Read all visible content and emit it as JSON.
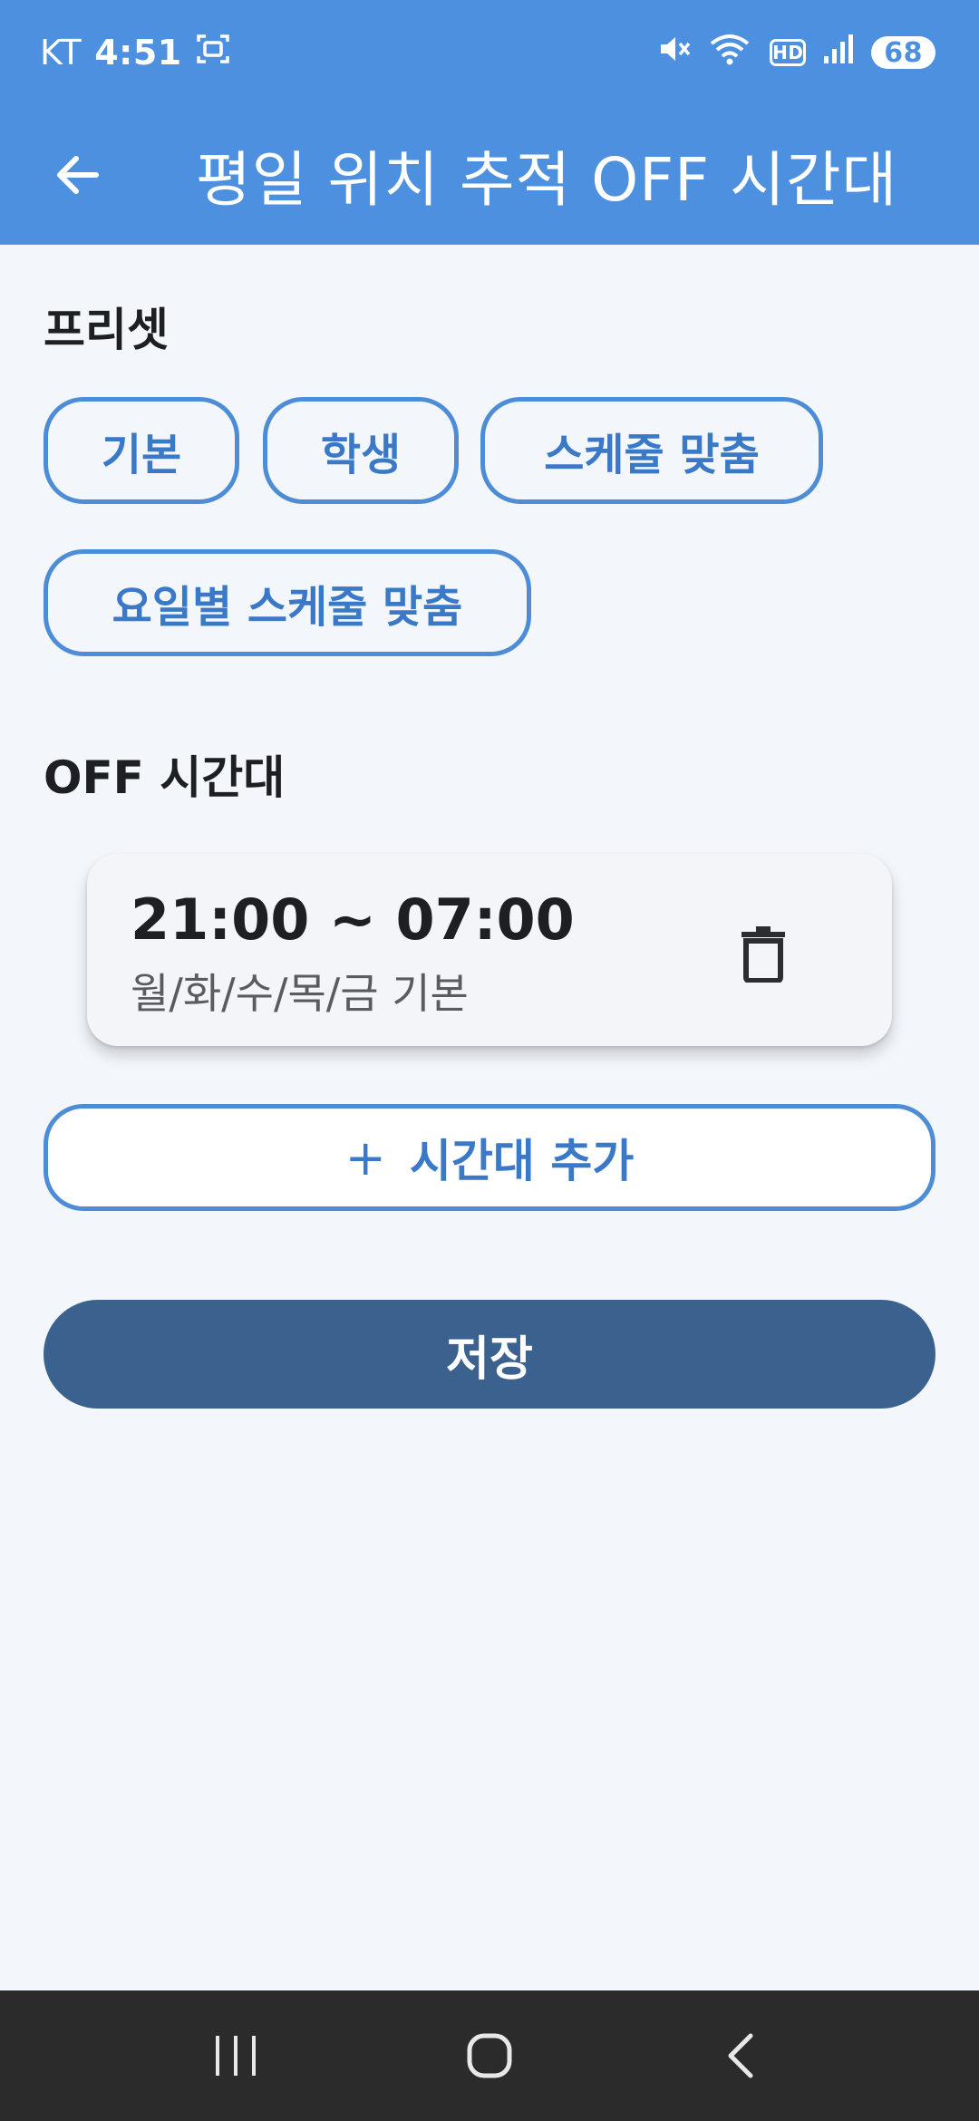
{
  "status_bar": {
    "carrier": "KT",
    "time": "4:51",
    "hd_badge": "HD",
    "battery": "68",
    "icons": [
      "screenshot-icon",
      "mute-icon",
      "wifi-icon",
      "hd-icon",
      "signal-icon",
      "battery-icon"
    ]
  },
  "app_bar": {
    "title": "평일 위치 추적 OFF 시간대",
    "back_icon": "arrow-left-icon"
  },
  "presets": {
    "title": "프리셋",
    "chips": [
      "기본",
      "학생",
      "스케줄 맞춤",
      "요일별 스케줄 맞춤"
    ]
  },
  "off_section": {
    "title": "OFF 시간대",
    "items": [
      {
        "time_range": "21:00 ~ 07:00",
        "days": "월/화/수/목/금 기본"
      }
    ]
  },
  "actions": {
    "add_plus": "+",
    "add_label": "시간대 추가",
    "save_label": "저장"
  },
  "colors": {
    "primary": "#4d90e0",
    "accent_text": "#3a79c7",
    "save_button": "#3b628f",
    "background": "#f3f7fc",
    "nav_bar": "#2b2b2b"
  }
}
